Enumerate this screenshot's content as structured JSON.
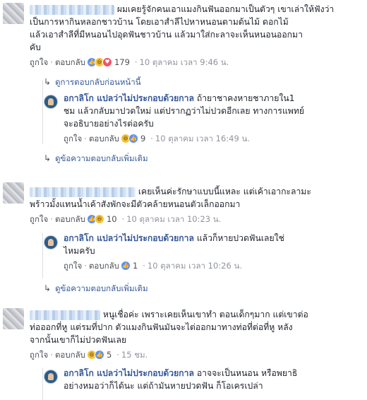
{
  "comments": [
    {
      "text_lines": [
        "ผมเคยรู้จักคนเอาแมงกินฟันออกมาเป็นตัวๆ เขาเล่าให้ฟังว่า",
        "เป็นการหากินหลอกชาวบ้าน โดยเอาสำลีไปหาหนอนตามต้นไม้ ดอกไม้",
        "แล้วเอาสำลีที่มีหนอนไปอุดฟันชาวบ้าน แล้วมาใส่กะลาจะเห็นหนอนออกมา",
        "คับ"
      ],
      "like": "ถูกใจ",
      "reply": "ตอบกลับ",
      "reactions": "179",
      "time": "10 ตุลาคม เวลา 9:46 น.",
      "prev_replies": "ดูการตอบกลับก่อนหน้านี้",
      "page_reply": {
        "name": "อกาลิโก แปลว่าไม่ประกอบด้วยกาล",
        "text_lines": [
          "ถ้ายาชาคงหายชาภายใน1",
          "ชม แล้วกลับมาปวดใหม่ แต่ปรากฏว่าไม่ปวดอีกเลย ทางการแพทย์",
          "จะอธิบายอย่างไรต่อครับ"
        ],
        "like": "ถูกใจ",
        "reply": "ตอบกลับ",
        "reactions": "9",
        "time": "10 ตุลาคม เวลา 16:49 น."
      },
      "more_replies": "ดูข้อความตอบกลับเพิ่มเติม"
    },
    {
      "text_lines": [
        "เคยเห็นค่ะรักษาแบบนี้แหละ แต่เค้าเอากะลามะ",
        "พร้าวมั้งแทนน้ำเค้าสังพักจะมีตัวคล้ายหนอนตัวเล็กออกมา"
      ],
      "like": "ถูกใจ",
      "reply": "ตอบกลับ",
      "reactions": "10",
      "time": "10 ตุลาคม เวลา 10:23 น.",
      "page_reply": {
        "name": "อกาลิโก แปลว่าไม่ประกอบด้วยกาล",
        "text_lines": [
          "แล้วก็หายปวดฟันเลยใช่",
          "ไหมครับ"
        ],
        "like": "ถูกใจ",
        "reply": "ตอบกลับ",
        "reactions": "1",
        "time": "10 ตุลาคม เวลา 10:26 น."
      },
      "more_replies": "ดูข้อความตอบกลับเพิ่มเติม"
    },
    {
      "text_lines": [
        "หนูเชื่อค่ะ เพราะเคยเห็นเขาทำ ตอนเด็กๆมาก แต่เขาต่อ",
        "ท่อออกที่หู แต่รมที่ปาก ตัวแมงกินฟันมันจะไต่ออกมาทางท่อที่ต่อที่หู หลัง",
        "จากนั้นเขาก็ไม่ปวดฟันเลย"
      ],
      "like": "ถูกใจ",
      "reply": "ตอบกลับ",
      "reactions": "5",
      "time": "15 ชม.",
      "page_reply": {
        "name": "อกาลิโก แปลว่าไม่ประกอบด้วยกาล",
        "text_lines": [
          "อาจจะเป็นหนอน หรือพยาธิ",
          "อย่างหมอว่าก็ได้นะ แต่ถ้ามันหายปวดฟัน ก็โอเครเปล่า"
        ]
      }
    }
  ]
}
